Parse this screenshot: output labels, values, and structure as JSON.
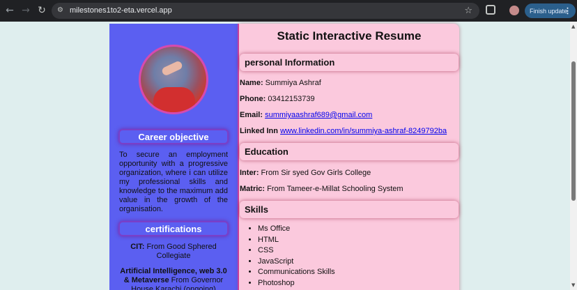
{
  "browser": {
    "url": "milestones1to2-eta.vercel.app",
    "finish_update_label": "Finish update"
  },
  "resume": {
    "title": "Static Interactive Resume",
    "left": {
      "career_heading": "Career objective",
      "career_text": "To secure an employment opportunity with a progressive organization, where i can utilize my professional skills and knowledge to the maximum add value in the growth of the organisation.",
      "cert_heading": "certifications",
      "certs": [
        {
          "bold": "CIT:",
          "text": " From Good Sphered Collegiate"
        },
        {
          "bold": "Artificial Intelligence, web 3.0 & Metaverse",
          "text": " From Governor House Karachi (ongoing)"
        }
      ]
    },
    "personal": {
      "heading": "personal Information",
      "name_label": "Name:",
      "name_value": " Summiya Ashraf",
      "phone_label": "Phone:",
      "phone_value": " 03412153739",
      "email_label": "Email:",
      "email_value": "summiyaashraf689@gmail.com",
      "linkedin_label": "Linked Inn",
      "linkedin_value": "www.linkedin.com/in/summiya-ashraf-8249792ba"
    },
    "education": {
      "heading": "Education",
      "inter_label": "Inter:",
      "inter_value": " From Sir syed Gov Girls College",
      "matric_label": "Matric:",
      "matric_value": " From Tameer-e-Millat Schooling System"
    },
    "skills": {
      "heading": "Skills",
      "items": [
        "Ms Office",
        "HTML",
        "CSS",
        "JavaScript",
        "Communications Skills",
        "Photoshop"
      ]
    }
  }
}
